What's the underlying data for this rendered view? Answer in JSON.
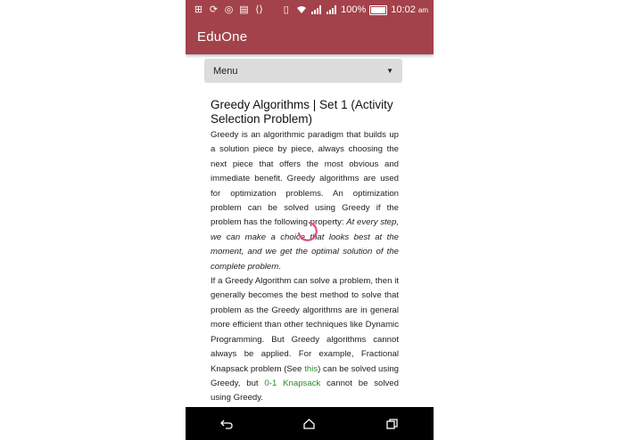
{
  "status_bar": {
    "battery": "100%",
    "time": "10:02",
    "ampm": "am",
    "icons": [
      "notification-plus-icon",
      "sync-icon",
      "whatsapp-icon",
      "keyboard-icon",
      "code-icon",
      "vibrate-icon",
      "wifi-icon",
      "signal-icon",
      "signal-icon",
      "battery-icon"
    ]
  },
  "app_bar": {
    "title": "EduOne"
  },
  "menu": {
    "selected": "Menu"
  },
  "article": {
    "title": "Greedy Algorithms | Set 1 (Activity Selection Problem)",
    "p1_a": "Greedy is an algorithmic paradigm that builds up a solution piece by piece, always choosing the next piece that offers the most obvious and immediate benefit. Greedy algorithms are used for optimization problems. An optimization problem can be solved using Greedy if the problem has the following property: ",
    "p1_em": "At every step, we can make a choice that looks best at the moment, and we get the optimal solution of the complete problem",
    "p1_end": ".",
    "p2_a": "If a Greedy Algorithm can solve a problem, then it generally becomes the best method to solve that problem as the Greedy algorithms are in general more efficient than other techniques like Dynamic Programming. But Greedy algorithms cannot always be applied. For example, Fractional Knapsack problem (See ",
    "p2_link1": "this",
    "p2_b": ") can be solved using Greedy, but ",
    "p2_link2": "0-1 Knapsack",
    "p2_c": " cannot be solved using Greedy."
  },
  "colors": {
    "app_bar": "#a3424a",
    "link": "#2a8a2a",
    "spinner": "#e0507a"
  }
}
